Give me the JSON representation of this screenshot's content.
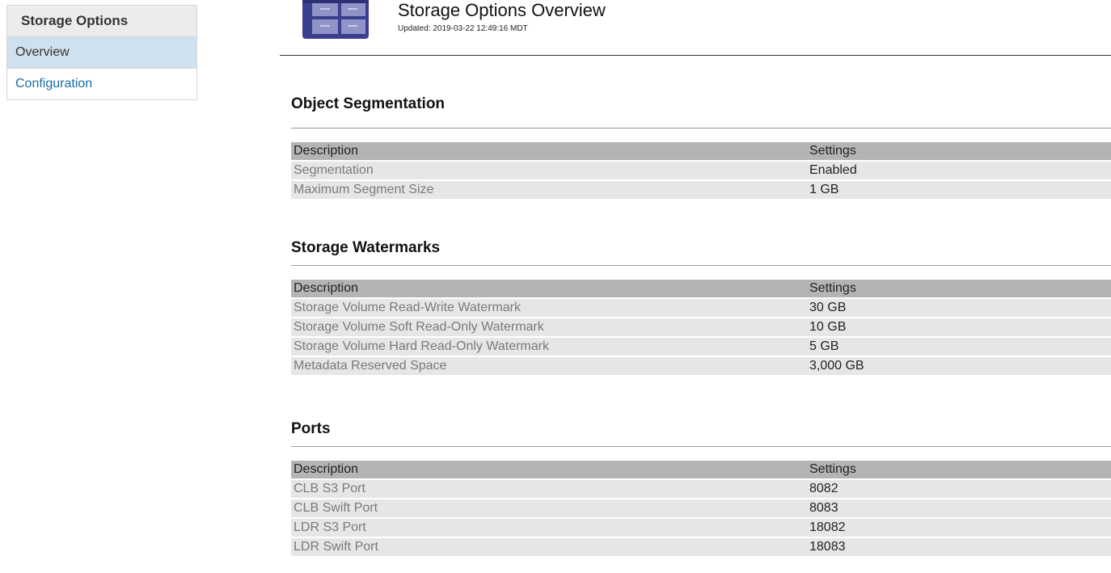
{
  "sidebar": {
    "title": "Storage Options",
    "items": [
      {
        "label": "Overview"
      },
      {
        "label": "Configuration"
      }
    ]
  },
  "header": {
    "title": "Storage Options Overview",
    "updated": "Updated: 2019-03-22 12:49:16 MDT",
    "icon": "storage-grid-icon"
  },
  "sections": [
    {
      "title": "Object Segmentation",
      "columns": [
        "Description",
        "Settings"
      ],
      "rows": [
        [
          "Segmentation",
          "Enabled"
        ],
        [
          "Maximum Segment Size",
          "1 GB"
        ]
      ]
    },
    {
      "title": "Storage Watermarks",
      "columns": [
        "Description",
        "Settings"
      ],
      "rows": [
        [
          "Storage Volume Read-Write Watermark",
          "30 GB"
        ],
        [
          "Storage Volume Soft Read-Only Watermark",
          "10 GB"
        ],
        [
          "Storage Volume Hard Read-Only Watermark",
          "5 GB"
        ],
        [
          "Metadata Reserved Space",
          "3,000 GB"
        ]
      ]
    },
    {
      "title": "Ports",
      "columns": [
        "Description",
        "Settings"
      ],
      "rows": [
        [
          "CLB S3 Port",
          "8082"
        ],
        [
          "CLB Swift Port",
          "8083"
        ],
        [
          "LDR S3 Port",
          "18082"
        ],
        [
          "LDR Swift Port",
          "18083"
        ]
      ]
    }
  ],
  "colors": {
    "active_nav": "#cfe1ee",
    "link": "#1a6ca8",
    "table_header": "#b4b4b4",
    "table_row": "#e6e6e6"
  }
}
